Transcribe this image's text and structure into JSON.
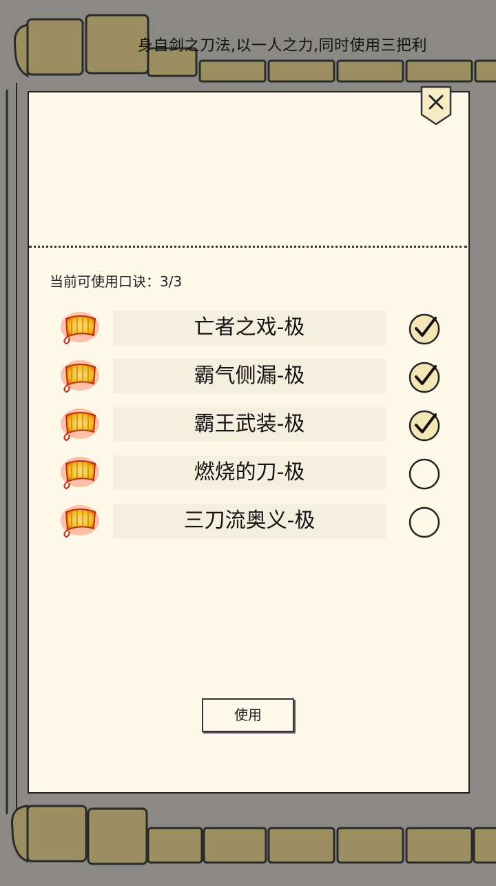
{
  "background": {
    "text": "身自剑之刀法,以一人之力,同时使用三把利"
  },
  "dialog": {
    "quota_label": "当前可使用口诀：",
    "quota_value": "3/3",
    "items": [
      {
        "label": "亡者之戏-极",
        "checked": true
      },
      {
        "label": "霸气侧漏-极",
        "checked": true
      },
      {
        "label": "霸王武装-极",
        "checked": true
      },
      {
        "label": "燃烧的刀-极",
        "checked": false
      },
      {
        "label": "三刀流奥义-极",
        "checked": false
      }
    ],
    "use_button": "使用"
  },
  "icons": {
    "close": "close-icon",
    "item": "scroll-icon",
    "checkbox": "check-circle-icon"
  }
}
